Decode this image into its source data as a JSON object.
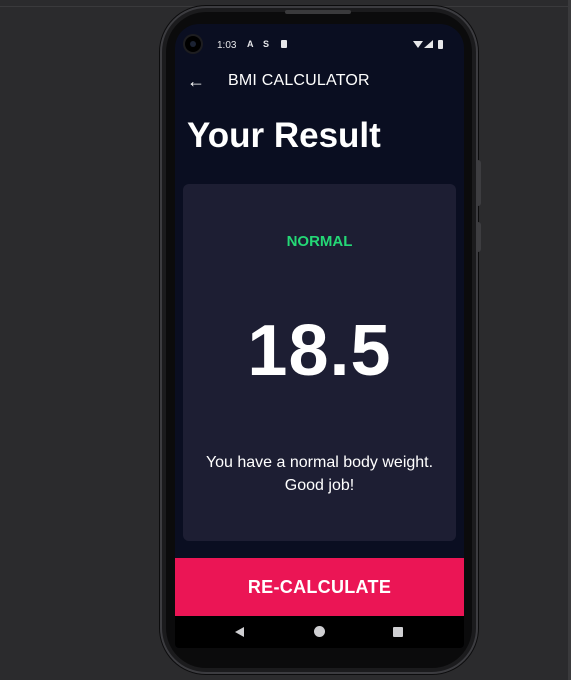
{
  "status_bar": {
    "time": "1:03",
    "icons": [
      "notification-a-icon",
      "notification-s-icon",
      "sd-card-icon",
      "wifi-icon",
      "signal-icon",
      "battery-icon"
    ],
    "a_glyph": "A",
    "s_glyph": "S"
  },
  "app_bar": {
    "back_icon": "arrow-back-icon",
    "back_glyph": "←",
    "title": "BMI CALCULATOR"
  },
  "page": {
    "title": "Your Result"
  },
  "result": {
    "status": "NORMAL",
    "status_color": "#24d876",
    "bmi": "18.5",
    "message": "You have a normal body weight. Good job!"
  },
  "action": {
    "recalculate_label": "RE-CALCULATE",
    "button_color": "#eb1555"
  },
  "colors": {
    "background": "#0a0e21",
    "card": "#1d1e33",
    "text": "#ffffff"
  },
  "nav_bar": {
    "icons": [
      "nav-back-icon",
      "nav-home-icon",
      "nav-recents-icon"
    ]
  }
}
